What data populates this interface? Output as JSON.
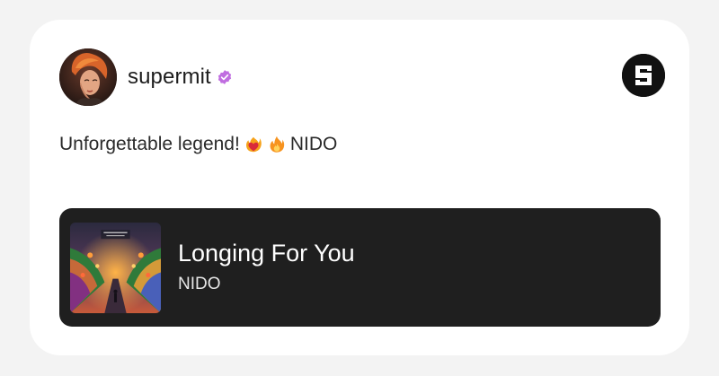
{
  "post": {
    "username": "supermit",
    "verified": true,
    "text": "Unforgettable legend!",
    "tag_after_emojis": "NIDO",
    "emojis": [
      "heart-on-fire-icon",
      "fire-icon"
    ]
  },
  "brand": {
    "icon": "s-logo-icon"
  },
  "track": {
    "title": "Longing For You",
    "artist": "NIDO",
    "cover_icon": "album-cover-art"
  },
  "colors": {
    "background": "#f3f3f3",
    "card": "#ffffff",
    "track_bg": "#1f1f1f",
    "verified": "#c06de0",
    "text_primary": "#1d1d1d"
  }
}
